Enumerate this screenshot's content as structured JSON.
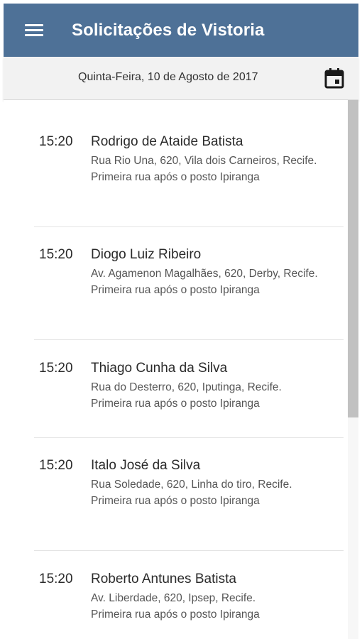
{
  "appbar": {
    "title": "Solicitações de Vistoria",
    "menu_icon": "menu-icon",
    "color": "#4e7197"
  },
  "datebar": {
    "date": "Quinta-Feira, 10 de Agosto de 2017",
    "calendar_icon": "calendar-icon"
  },
  "items": [
    {
      "time": "15:20",
      "name": "Rodrigo de Ataide Batista",
      "address": "Rua Rio Una, 620, Vila dois Carneiros, Recife.",
      "note": "Primeira rua após o posto Ipiranga"
    },
    {
      "time": "15:20",
      "name": "Diogo Luiz Ribeiro",
      "address": "Av. Agamenon Magalhães, 620, Derby, Recife.",
      "note": "Primeira rua após o posto Ipiranga"
    },
    {
      "time": "15:20",
      "name": "Thiago Cunha da Silva",
      "address": "Rua do Desterro, 620, Iputinga, Recife.",
      "note": "Primeira rua após o posto Ipiranga"
    },
    {
      "time": "15:20",
      "name": "Italo José da Silva",
      "address": "Rua Soledade, 620, Linha do tiro, Recife.",
      "note": "Primeira rua após o posto Ipiranga"
    },
    {
      "time": "15:20",
      "name": "Roberto Antunes Batista",
      "address": "Av. Liberdade, 620, Ipsep, Recife.",
      "note": "Primeira rua após o posto Ipiranga"
    }
  ]
}
